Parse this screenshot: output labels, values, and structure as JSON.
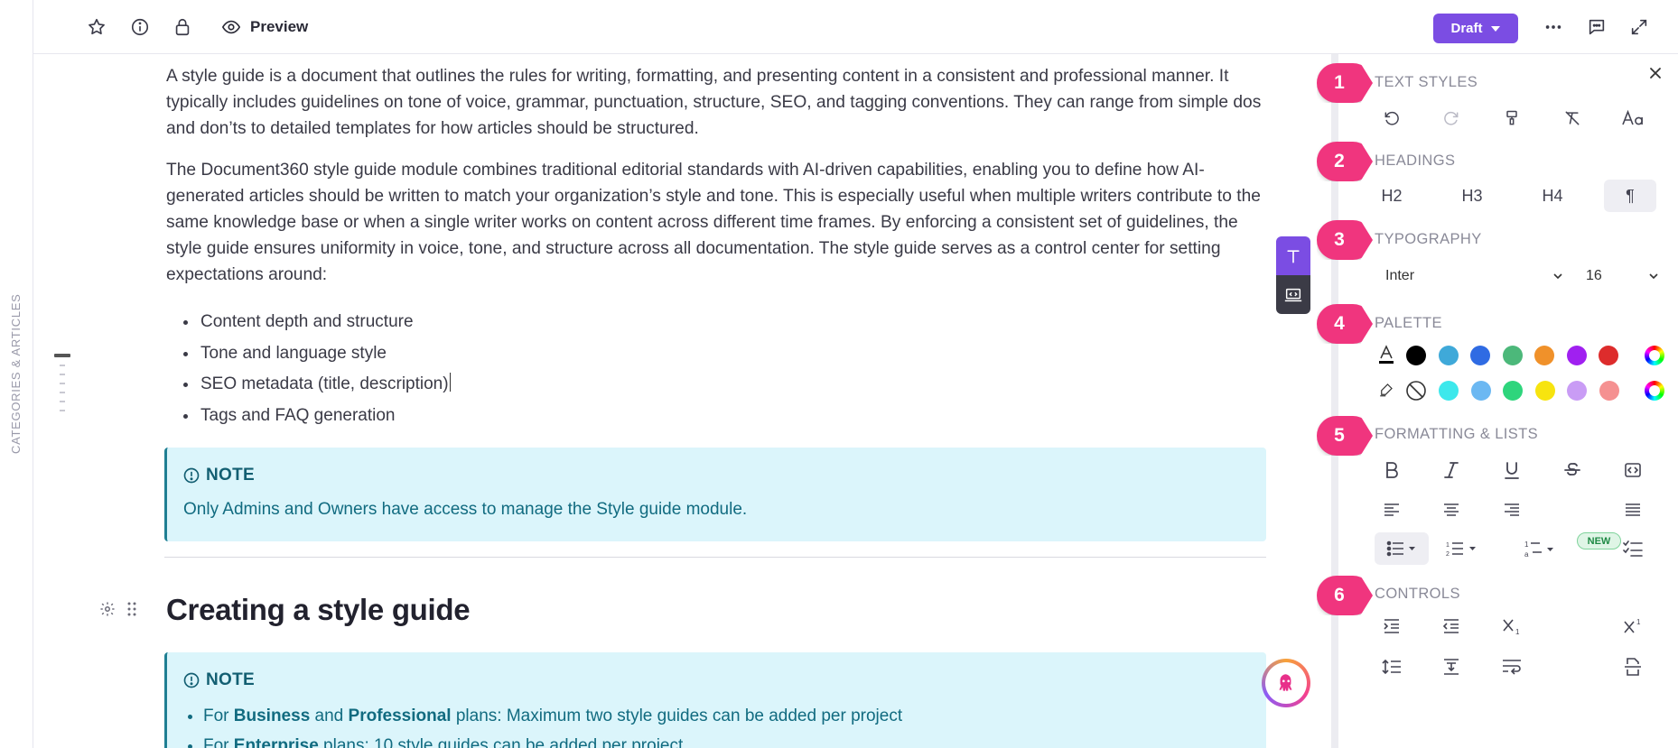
{
  "leftrail": {
    "label": "CATEGORIES & ARTICLES"
  },
  "topbar": {
    "preview_label": "Preview",
    "draft_label": "Draft"
  },
  "article": {
    "p1": "A style guide is a document that outlines the rules for writing, formatting, and presenting content in a consistent and professional manner. It typically includes guidelines on tone of voice, grammar, punctuation, structure, SEO, and tagging conventions. They can range from simple dos and don’ts to detailed templates for how articles should be structured.",
    "p2": "The Document360 style guide module combines traditional editorial standards with AI-driven capabilities, enabling you to define how AI-generated articles should be written to match your organization’s style and tone. This is especially useful when multiple writers contribute to the same knowledge base or when a single writer works on content across different time frames. By enforcing a consistent set of guidelines, the style guide ensures uniformity in voice, tone, and structure across all documentation. The style guide serves as a control center for setting expectations around:",
    "bullets": [
      "Content depth and structure",
      "Tone and language style",
      "SEO metadata (title, description)",
      "Tags and FAQ generation"
    ],
    "note1": {
      "title": "NOTE",
      "text": "Only Admins and Owners have access to manage the Style guide module."
    },
    "heading": "Creating a style guide",
    "note2": {
      "title": "NOTE",
      "item1": {
        "pre": "For ",
        "b1": "Business",
        "mid": " and ",
        "b2": "Professional",
        "post": " plans: Maximum two style guides can be added per project"
      },
      "item2": {
        "pre": "For ",
        "b1": "Enterprise",
        "post": " plans: 10 style guides can be added per project"
      }
    }
  },
  "panel": {
    "sections": [
      "TEXT STYLES",
      "HEADINGS",
      "TYPOGRAPHY",
      "PALETTE",
      "FORMATTING & LISTS",
      "CONTROLS"
    ],
    "badges": [
      "1",
      "2",
      "3",
      "4",
      "5",
      "6"
    ],
    "headings": [
      "H2",
      "H3",
      "H4",
      "¶"
    ],
    "font_name": "Inter",
    "font_size": "16",
    "new_badge": "NEW",
    "palette_text": [
      "#000000",
      "#3fa9d9",
      "#2f6be3",
      "#4cb87a",
      "#f0912a",
      "#a020f0",
      "#dd2c2c"
    ],
    "palette_highlight": [
      "#3de8ec",
      "#6cb8f2",
      "#2ed57c",
      "#f7e40f",
      "#c99cf5",
      "#f59191"
    ],
    "accent": "#7b4de3",
    "badge_color": "#f0357e"
  }
}
